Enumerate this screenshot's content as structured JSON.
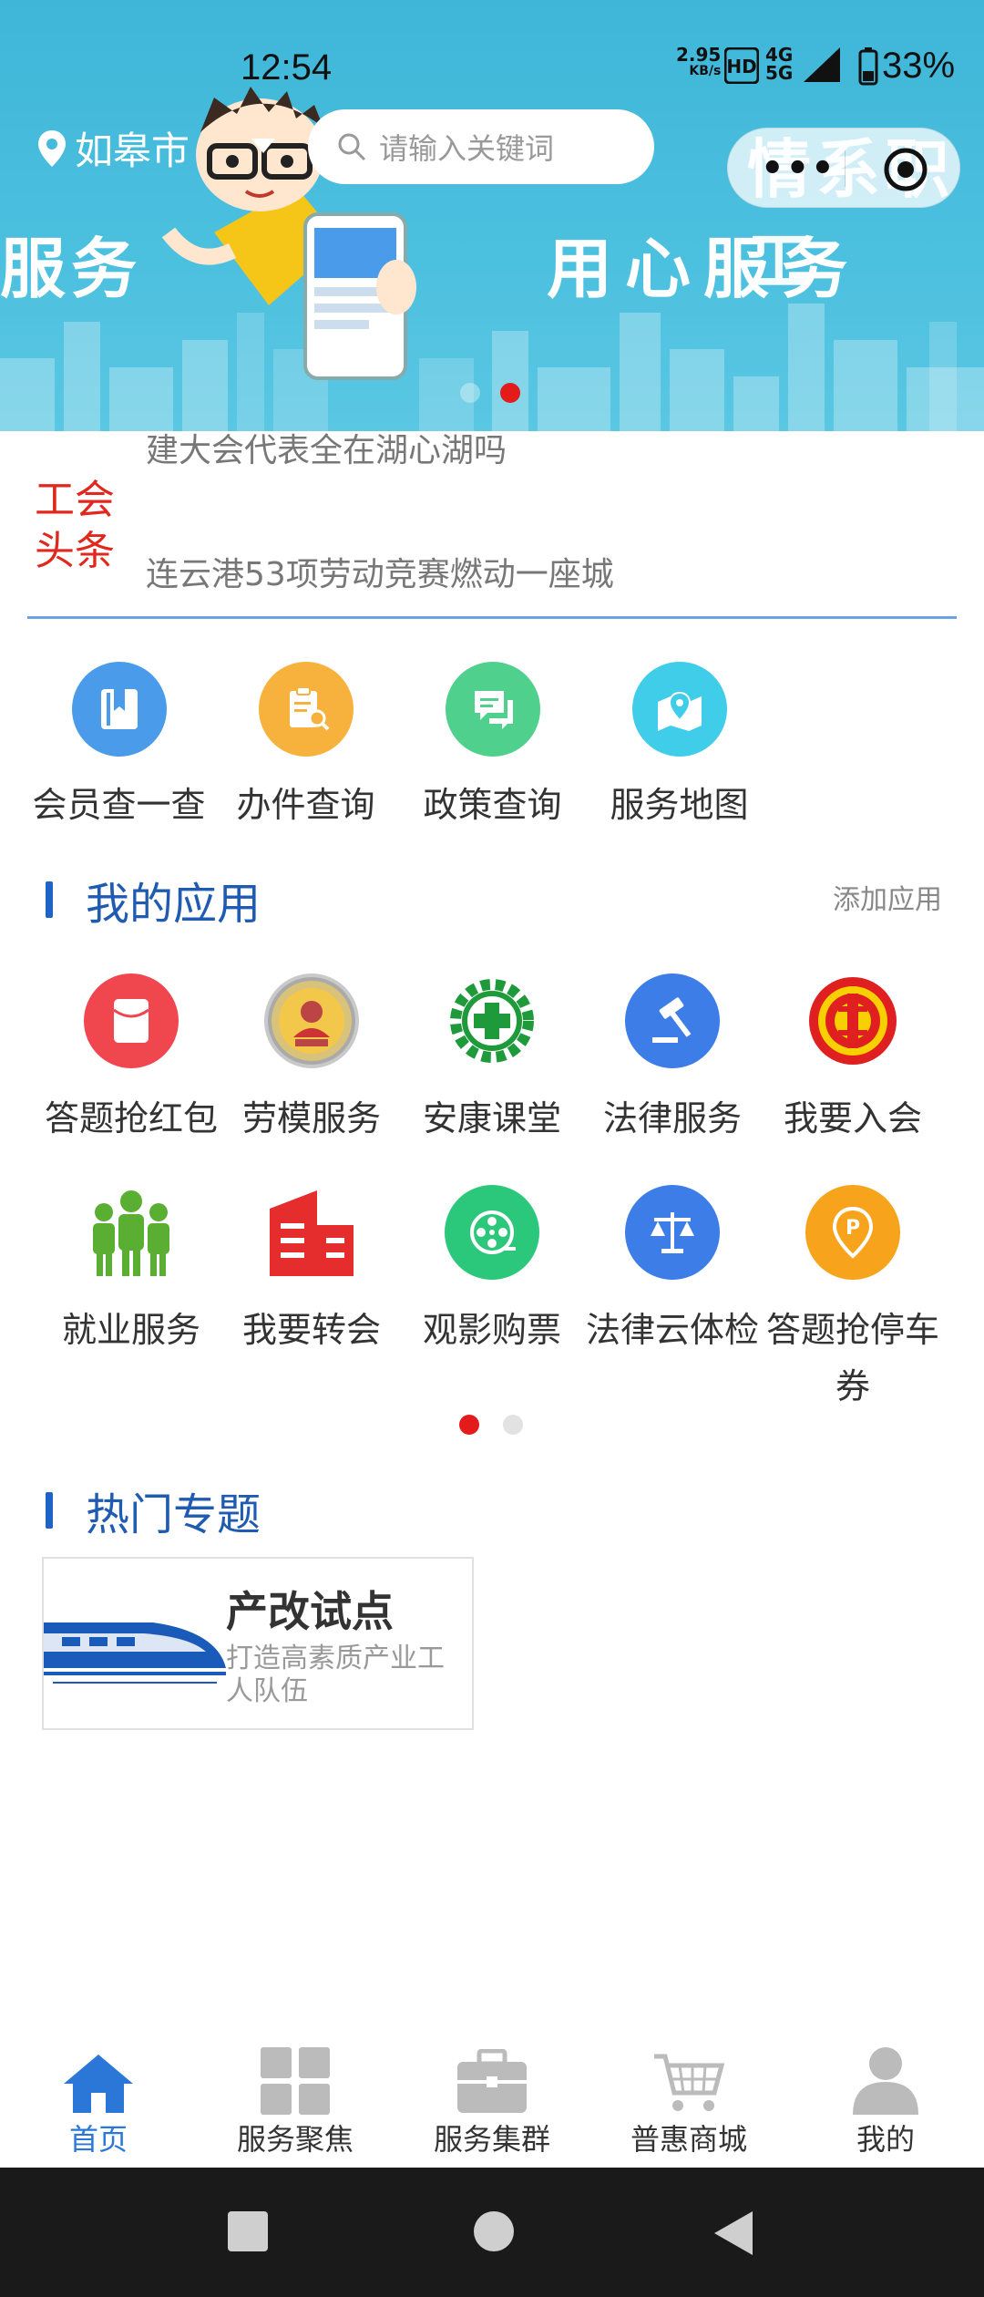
{
  "status_bar": {
    "time": "12:54",
    "speed_value": "2.95",
    "speed_unit": "KB/s",
    "network_top": "4G",
    "network_bottom": "5G",
    "battery": "33%"
  },
  "banner": {
    "slogan_top": "情系职工",
    "slogan_bottom": "用心服务",
    "slogan_left": "服务",
    "active_slide": 2,
    "slide_count": 2
  },
  "header": {
    "location": "如皋市",
    "search_placeholder": "请输入关键词"
  },
  "news": {
    "label_line1": "工会",
    "label_line2": "头条",
    "headline_prev": "建大会代表全在湖心湖吗",
    "headline": "连云港53项劳动竞赛燃动一座城"
  },
  "quick_services": [
    {
      "label": "会员查一查",
      "icon": "bookmark-icon",
      "color": "#4a9bea"
    },
    {
      "label": "办件查询",
      "icon": "document-search-icon",
      "color": "#f6b23c"
    },
    {
      "label": "政策查询",
      "icon": "chat-bubble-icon",
      "color": "#4fd08c"
    },
    {
      "label": "服务地图",
      "icon": "map-pin-icon",
      "color": "#3fcdea"
    }
  ],
  "my_apps": {
    "title": "我的应用",
    "add_label": "添加应用",
    "items": [
      {
        "label": "答题抢红包",
        "icon": "red-envelope-icon"
      },
      {
        "label": "劳模服务",
        "icon": "model-worker-badge-icon"
      },
      {
        "label": "安康课堂",
        "icon": "safety-cross-gear-icon"
      },
      {
        "label": "法律服务",
        "icon": "gavel-icon"
      },
      {
        "label": "我要入会",
        "icon": "union-emblem-icon"
      },
      {
        "label": "就业服务",
        "icon": "people-group-icon"
      },
      {
        "label": "我要转会",
        "icon": "building-icon"
      },
      {
        "label": "观影购票",
        "icon": "film-reel-icon"
      },
      {
        "label": "法律云体检",
        "icon": "scales-icon"
      },
      {
        "label": "答题抢停车券",
        "icon": "parking-pin-icon"
      }
    ],
    "page": 1,
    "page_count": 2
  },
  "topics": {
    "title": "热门专题",
    "card_title": "产改试点",
    "card_subtitle": "打造高素质产业工人队伍"
  },
  "tabbar": [
    {
      "label": "首页",
      "icon": "home-icon",
      "active": true
    },
    {
      "label": "服务聚焦",
      "icon": "grid-icon",
      "active": false
    },
    {
      "label": "服务集群",
      "icon": "briefcase-icon",
      "active": false
    },
    {
      "label": "普惠商城",
      "icon": "shopping-cart-icon",
      "active": false
    },
    {
      "label": "我的",
      "icon": "user-icon",
      "active": false
    }
  ],
  "colors": {
    "accent_blue": "#1f5bb0",
    "tab_active": "#2a77d8",
    "news_red": "#e0281f",
    "pager_active": "#e31b1b"
  }
}
